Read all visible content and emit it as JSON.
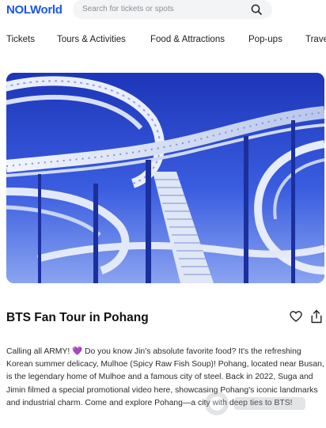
{
  "header": {
    "logo_part1": "NOL",
    "logo_part2": "World",
    "search_placeholder": "Search for tickets or spots"
  },
  "tabs": [
    {
      "label": "Tickets"
    },
    {
      "label": "Tours & Activities"
    },
    {
      "label": "Food & Attractions"
    },
    {
      "label": "Pop-ups"
    },
    {
      "label": "Trave"
    }
  ],
  "post": {
    "title": "BTS Fan Tour in Pohang",
    "description": "Calling all ARMY! 💜 Do you know Jin's absolute favorite food? It's the refreshing Korean summer delicacy, Mulhoe (Spicy Raw Fish Soup)! Pohang, located near Busan, is the legendary home of Mulhoe and a famous city of steel. Back in 2022, Suga and Jimin filmed a special promotional video here, showcasing Pohang's iconic landmarks and industrial charm. Come and explore Pohang—a city with deep ties to BTS!"
  },
  "icons": {
    "search": "search-icon",
    "like": "heart-icon",
    "share": "share-icon"
  },
  "colors": {
    "brand": "#1a56e8",
    "sky": "#2541c9",
    "structure": "#dfe6f5"
  }
}
